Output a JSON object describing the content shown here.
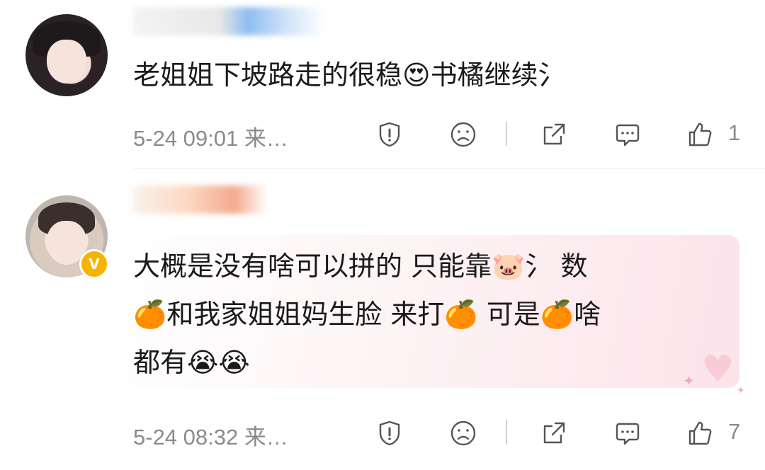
{
  "comments": [
    {
      "text": "老姐姐下坡路走的很稳😍书橘继续氵",
      "timestamp": "5-24 09:01 来…",
      "like_count": "1",
      "verified": false
    },
    {
      "text": "大概是没有啥可以拼的 只能靠🐷氵 数\n🍊和我家姐姐妈生脸 来打🍊 可是🍊啥\n都有😭😭",
      "timestamp": "5-24 08:32 来…",
      "like_count": "7",
      "verified": true,
      "verified_badge": "V"
    }
  ],
  "icons": [
    "report-icon",
    "sad-face-icon",
    "share-icon",
    "reply-icon",
    "like-icon"
  ],
  "colors": {
    "meta_text": "#8a8a8a",
    "badge": "#f6b400",
    "bubble_tint": "#fbe3ea"
  }
}
